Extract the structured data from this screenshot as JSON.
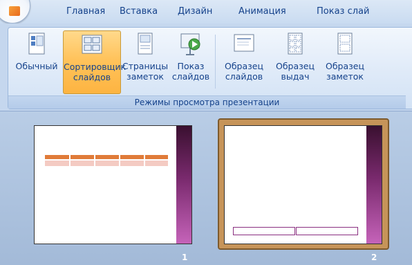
{
  "tabs": [
    "Главная",
    "Вставка",
    "Дизайн",
    "Анимация",
    "Показ слай"
  ],
  "ribbon": {
    "buttons": [
      {
        "line1": "Обычный",
        "line2": "",
        "icon": "normal-view-icon"
      },
      {
        "line1": "Сортировщик",
        "line2": "слайдов",
        "icon": "slide-sorter-icon",
        "active": true
      },
      {
        "line1": "Страницы",
        "line2": "заметок",
        "icon": "notes-page-icon"
      },
      {
        "line1": "Показ",
        "line2": "слайдов",
        "icon": "slide-show-icon"
      },
      {
        "line1": "Образец",
        "line2": "слайдов",
        "icon": "slide-master-icon"
      },
      {
        "line1": "Образец",
        "line2": "выдач",
        "icon": "handout-master-icon"
      },
      {
        "line1": "Образец",
        "line2": "заметок",
        "icon": "notes-master-icon"
      }
    ],
    "group_caption": "Режимы просмотра презентации"
  },
  "slides": [
    {
      "number": "1",
      "selected": false
    },
    {
      "number": "2",
      "selected": true
    }
  ],
  "colors": {
    "accent_orange": "#e07b39",
    "stripe_purple": "#7a2a6e",
    "selection": "#c69459"
  }
}
